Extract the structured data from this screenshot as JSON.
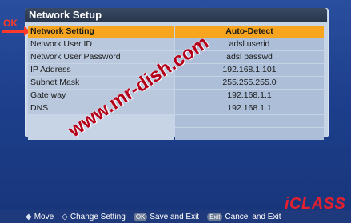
{
  "screen": {
    "title": "Network Setup",
    "ok_label": "OK",
    "watermark": "www.mr-dish.com",
    "brand": "iCLASS"
  },
  "settings": {
    "rows": [
      {
        "label": "Network Setting",
        "value": "Auto-Detect",
        "selected": true
      },
      {
        "label": "Network User ID",
        "value": "adsl userid"
      },
      {
        "label": "Network User Password",
        "value": "adsl passwd"
      },
      {
        "label": "IP Address",
        "value": "192.168.1.101"
      },
      {
        "label": "Subnet Mask",
        "value": "255.255.255.0"
      },
      {
        "label": "Gate way",
        "value": "192.168.1.1"
      },
      {
        "label": "DNS",
        "value": "192.168.1.1"
      },
      {
        "label": "",
        "value": ""
      },
      {
        "label": "",
        "value": ""
      }
    ]
  },
  "help": {
    "move_symbol": "◆",
    "move": "Move",
    "change_symbol": "◇",
    "change": "Change Setting",
    "ok_key": "OK",
    "save": "Save and Exit",
    "exit_key": "Exit",
    "cancel": "Cancel and Exit"
  }
}
